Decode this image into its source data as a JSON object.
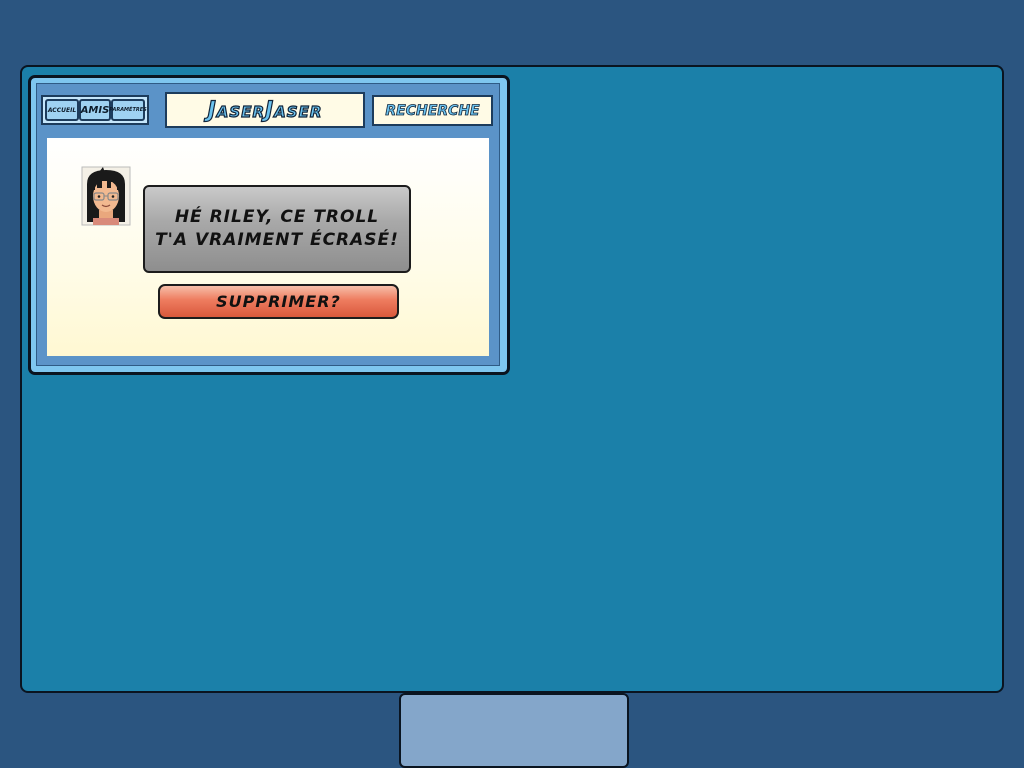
{
  "app": {
    "logo": "JaserJaser",
    "nav": {
      "home_label": "ACCUEIL",
      "friends_label": "AMIS",
      "settings_label": "PARAMÈTRES"
    },
    "search_label": "RECHERCHE"
  },
  "post": {
    "message": "HÉ RILEY, CE TROLL\nT'A VRAIMENT ÉCRASÉ!",
    "delete_label": "SUPPRIMER?"
  },
  "colors": {
    "background": "#2b5580",
    "screen": "#1b80a9",
    "window_frame": "#7ec6ef",
    "bubble": "#a9a9a9",
    "delete_button": "#ee7c5f",
    "bottom_tab": "#84a6ca"
  }
}
